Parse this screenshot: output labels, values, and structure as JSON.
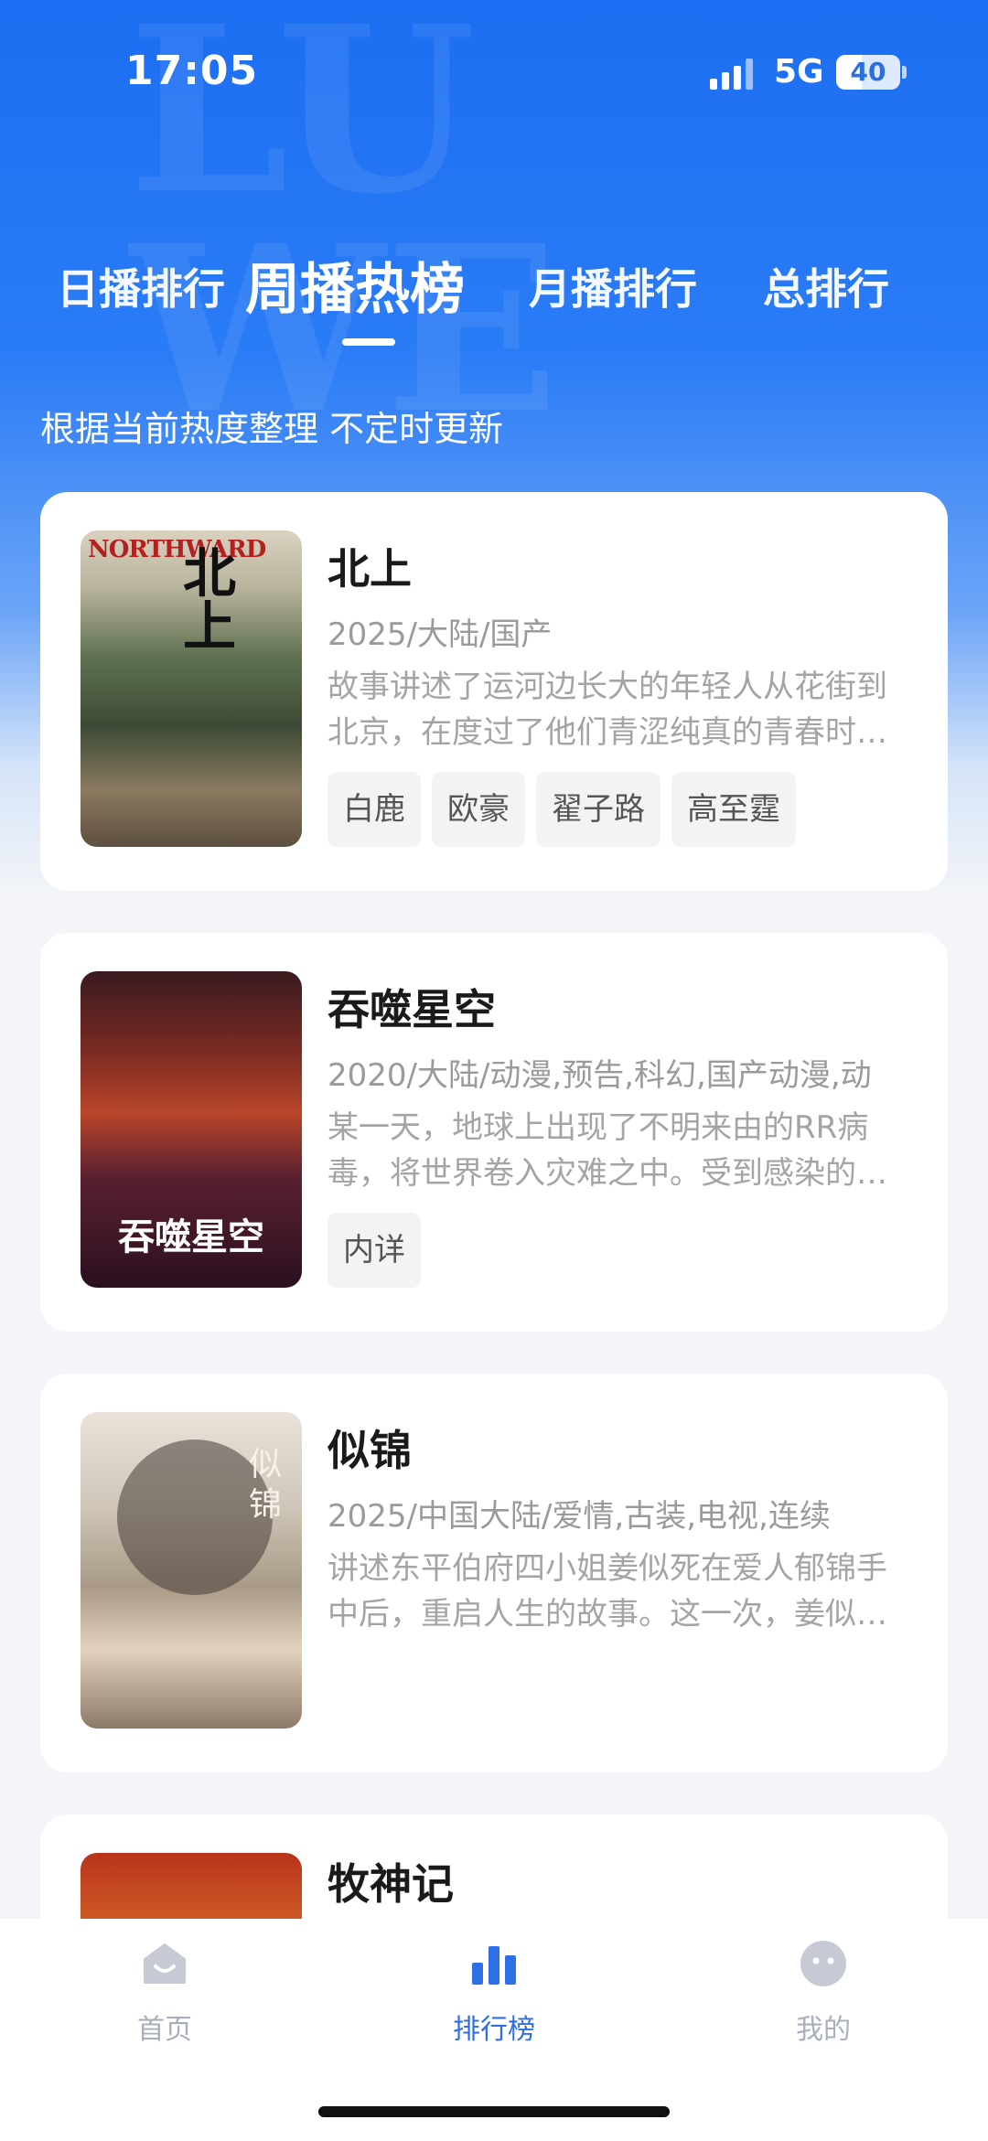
{
  "status_bar": {
    "time": "17:05",
    "network": "5G",
    "battery": "40",
    "battery_level": 0.4
  },
  "tabs": [
    {
      "label": "日播排行",
      "active": false
    },
    {
      "label": "周播热榜",
      "active": true
    },
    {
      "label": "月播排行",
      "active": false
    },
    {
      "label": "总排行",
      "active": false
    }
  ],
  "subtitle": "根据当前热度整理 不定时更新",
  "items": [
    {
      "title": "北上",
      "meta": "2025/大陆/国产",
      "desc": "故事讲述了运河边长大的年轻人从花街到北京，在度过了他们青涩纯真的青春时…",
      "tags": [
        "白鹿",
        "欧豪",
        "翟子路",
        "高至霆"
      ],
      "poster_caption": "NORTHWARD"
    },
    {
      "title": "吞噬星空",
      "meta": "2020/大陆/动漫,预告,科幻,国产动漫,动",
      "desc": "某一天，地球上出现了不明来由的RR病毒，将世界卷入灾难之中。受到感染的…",
      "tags": [
        "内详"
      ],
      "poster_caption": "吞噬星空"
    },
    {
      "title": "似锦",
      "meta": "2025/中国大陆/爱情,古装,电视,连续",
      "desc": "讲述东平伯府四小姐姜似死在爱人郁锦手中后，重启人生的故事。这一次，姜似…",
      "tags": [],
      "poster_caption": "似锦"
    },
    {
      "title": "牧神记",
      "meta": "",
      "desc": "",
      "tags": [],
      "poster_caption": ""
    }
  ],
  "bottom_nav": [
    {
      "label": "首页",
      "icon": "home-icon",
      "active": false
    },
    {
      "label": "排行榜",
      "icon": "ranking-icon",
      "active": true
    },
    {
      "label": "我的",
      "icon": "profile-icon",
      "active": false
    }
  ],
  "colors": {
    "accent": "#2f6fe6",
    "header_blue": "#1c6ef2",
    "nav_inactive": "#a9afba"
  }
}
